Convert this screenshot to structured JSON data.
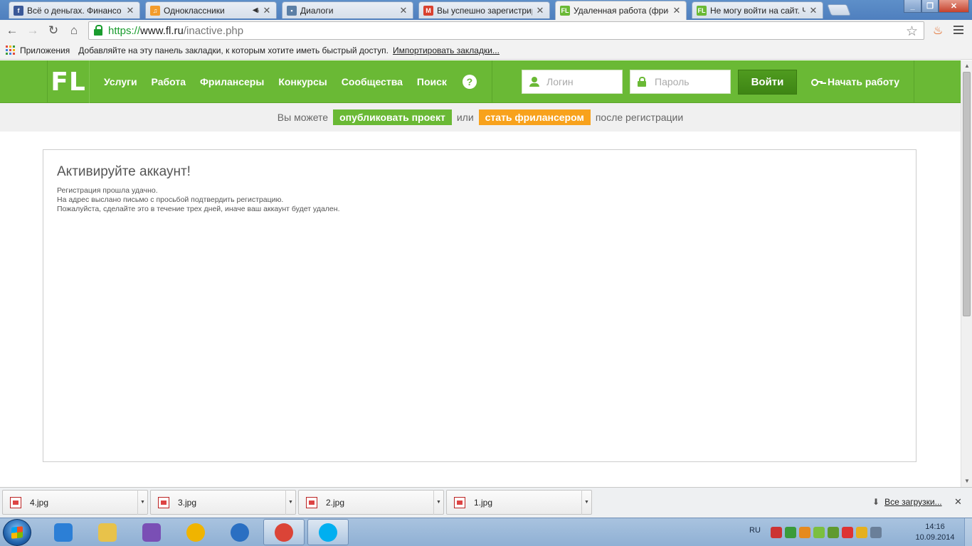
{
  "browser": {
    "tabs": [
      {
        "title": "Всё о деньгах. Финансо",
        "favicon": "facebook-icon",
        "color": "#3b5998",
        "glyph": "f"
      },
      {
        "title": "Одноклассники",
        "favicon": "odnoklassniki-icon",
        "color": "#f39c2c",
        "glyph": "♫",
        "audio": "◀ᵢ"
      },
      {
        "title": "Диалоги",
        "favicon": "vk-dialogs-icon",
        "color": "#5b7fa6",
        "glyph": "▪"
      },
      {
        "title": "Вы успешно зарегистрир",
        "favicon": "gmail-icon",
        "color": "#d9412f",
        "glyph": "M"
      },
      {
        "title": "Удаленная работа (фри-",
        "favicon": "fl-icon",
        "color": "#6ab935",
        "glyph": "FL",
        "active": true
      },
      {
        "title": "Не могу войти на сайт. Ч",
        "favicon": "fl-icon",
        "color": "#6ab935",
        "glyph": "FL"
      }
    ],
    "close_glyph": "✕",
    "url": {
      "scheme": "https://",
      "host": "www.fl.ru",
      "path": "/inactive.php"
    },
    "bookmarks": {
      "apps_label": "Приложения",
      "hint": "Добавляйте на эту панель закладки, к которым хотите иметь быстрый доступ.",
      "import_label": "Импортировать закладки..."
    }
  },
  "site": {
    "logo": "FL",
    "nav": [
      "Услуги",
      "Работа",
      "Фрилансеры",
      "Конкурсы",
      "Сообщества",
      "Поиск"
    ],
    "help_glyph": "?",
    "login_placeholder": "Логин",
    "password_placeholder": "Пароль",
    "login_button": "Войти",
    "start_link": "Начать работу",
    "promo": {
      "prefix": "Вы можете",
      "publish": "опубликовать проект",
      "or": "или",
      "become": "стать фрилансером",
      "suffix": "после регистрации"
    },
    "activation": {
      "title": "Активируйте аккаунт!",
      "lines": [
        "Регистрация прошла удачно.",
        "На адрес выслано письмо с просьбой подтвердить регистрацию.",
        "Пожалуйста, сделайте это в течение трех дней, иначе ваш аккаунт будет удален."
      ]
    },
    "colors": {
      "brand_green": "#6ab935",
      "orange": "#f8a21c"
    }
  },
  "downloads": {
    "items": [
      "4.jpg",
      "3.jpg",
      "2.jpg",
      "1.jpg"
    ],
    "all_label": "Все загрузки...",
    "close_glyph": "✕"
  },
  "taskbar": {
    "apps": [
      {
        "name": "media-player-icon",
        "color": "#2c7fd6"
      },
      {
        "name": "explorer-folder-icon",
        "color": "#e8c24a"
      },
      {
        "name": "visual-studio-icon",
        "color": "#7a4fb5"
      },
      {
        "name": "mail-agent-icon",
        "color": "#f0b400"
      },
      {
        "name": "ie-browser-icon",
        "color": "#2a6fc2"
      },
      {
        "name": "chrome-icon",
        "color": "#db4437",
        "active": true
      },
      {
        "name": "skype-icon",
        "color": "#00aff0",
        "active": true
      }
    ],
    "lang": "RU",
    "time": "14:16",
    "date": "10.09.2014"
  }
}
